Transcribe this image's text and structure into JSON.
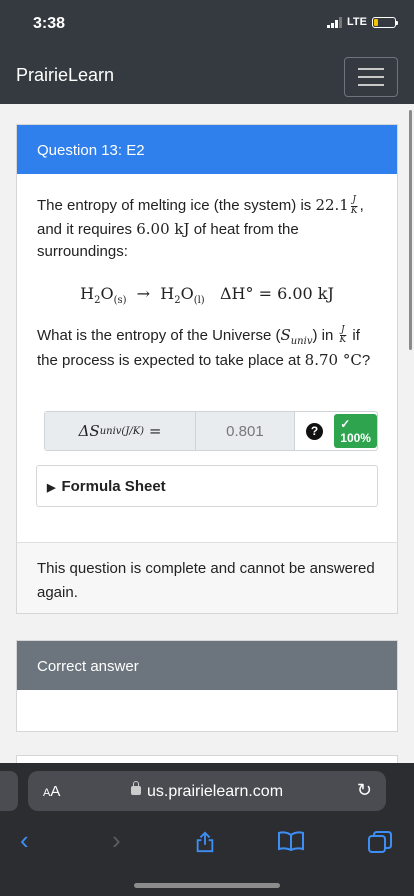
{
  "status": {
    "time": "3:38",
    "network": "LTE"
  },
  "nav": {
    "brand": "PrairieLearn"
  },
  "question": {
    "header": "Question 13: E2",
    "p1_a": "The entropy of melting ice (the system) is",
    "entropy_value": "22.1",
    "unit_num": "J",
    "unit_den": "K",
    "p1_b": ", and it requires",
    "heat_value": "6.00 kJ",
    "p1_c": "of heat from the surroundings:",
    "reaction": {
      "left": "H",
      "sub2": "2",
      "o": "O",
      "sub_s": "(s)",
      "arrow": "→",
      "sub_l": "(l)",
      "dh": "ΔH° = 6.00 kJ"
    },
    "p2_a": "What is the entropy of the Universe (",
    "s_symbol": "S",
    "s_sub": "univ",
    "p2_b": ") in",
    "p2_c": "if the process is expected to take place at",
    "temp": "8.70 °C",
    "p2_d": "?",
    "answer": {
      "label": "ΔS",
      "label_sub": "univ(J/K)",
      "equals": "=",
      "value": "0.801",
      "help": "?",
      "score": "✓ 100%"
    },
    "formula_sheet": "Formula Sheet",
    "footer": "This question is complete and cannot be answered again."
  },
  "correct_answer": {
    "header": "Correct answer"
  },
  "browser": {
    "aa_big": "A",
    "aa_small": "A",
    "url": "us.prairielearn.com"
  },
  "colors": {
    "accent": "#2f80ed",
    "nav": "#343a40",
    "success": "#2ea44f",
    "secondary": "#6c757d"
  }
}
